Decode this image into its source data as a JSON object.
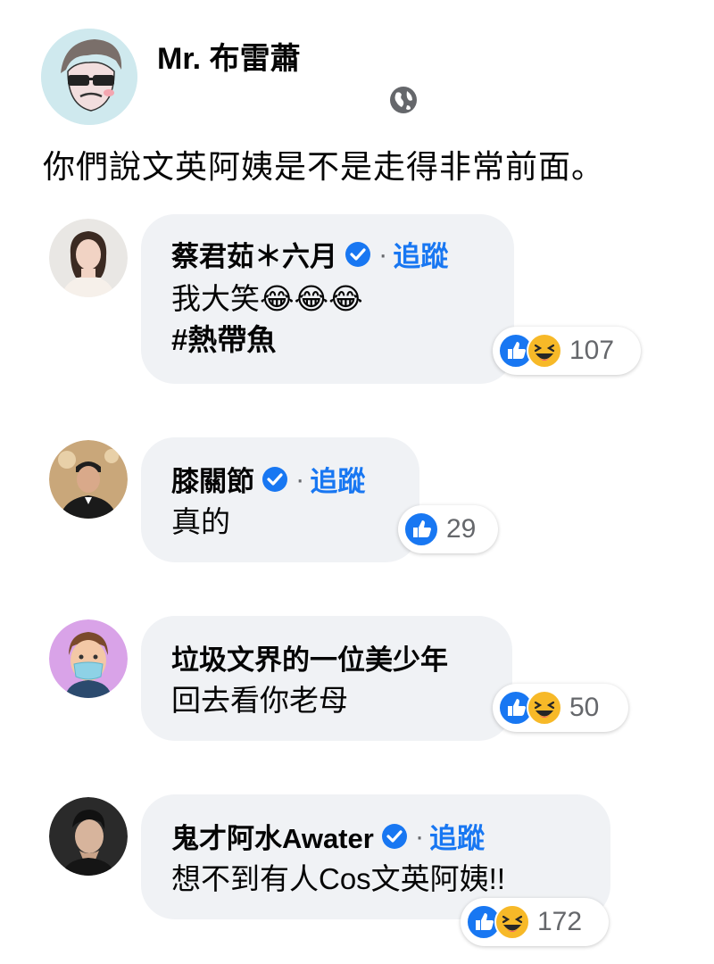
{
  "post": {
    "author": "Mr. 布雷蕭",
    "text": "你們說文英阿姨是不是走得非常前面。",
    "privacy_icon": "globe-icon"
  },
  "comments": [
    {
      "name": "蔡君茹＊六月",
      "verified": true,
      "follow_label": "追蹤",
      "separator": "·",
      "lines": [
        "我大笑😂😂😂",
        "#熱帶魚"
      ],
      "reactions": [
        "like",
        "haha"
      ],
      "count": "107"
    },
    {
      "name": "膝關節",
      "verified": true,
      "follow_label": "追蹤",
      "separator": "·",
      "lines": [
        "真的"
      ],
      "reactions": [
        "like"
      ],
      "count": "29"
    },
    {
      "name": "垃圾文界的一位美少年",
      "verified": false,
      "lines": [
        "回去看你老母"
      ],
      "reactions": [
        "like",
        "haha"
      ],
      "count": "50"
    },
    {
      "name": "鬼才阿水Awater",
      "verified": true,
      "follow_label": "追蹤",
      "separator": "·",
      "lines": [
        "想不到有人Cos文英阿姨!!"
      ],
      "reactions": [
        "like",
        "haha"
      ],
      "count": "172"
    }
  ],
  "colors": {
    "link_blue": "#1877f2",
    "bubble_bg": "#f0f2f5",
    "muted_text": "#65676b",
    "haha_yellow": "#f7b928"
  }
}
